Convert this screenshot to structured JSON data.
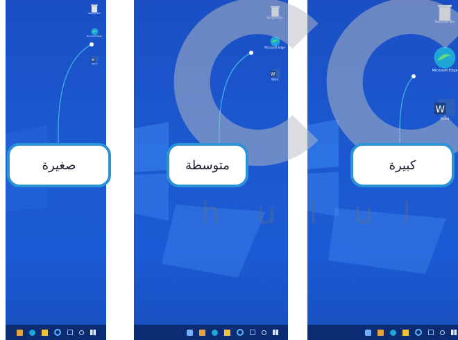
{
  "panels": [
    {
      "size_label": "صغيرة",
      "icons": [
        {
          "name": "recycle-bin",
          "label": "Recycle Bin"
        },
        {
          "name": "microsoft-edge",
          "label": "Microsoft Edge"
        },
        {
          "name": "word",
          "label": "Word"
        }
      ]
    },
    {
      "size_label": "متوسطة",
      "icons": [
        {
          "name": "recycle-bin",
          "label": "Recycle Bin"
        },
        {
          "name": "microsoft-edge",
          "label": "Microsoft Edge"
        },
        {
          "name": "word",
          "label": "Word"
        }
      ]
    },
    {
      "size_label": "كبيرة",
      "icons": [
        {
          "name": "recycle-bin",
          "label": "Recycle Bin"
        },
        {
          "name": "microsoft-edge",
          "label": "Microsoft Edge"
        },
        {
          "name": "word",
          "label": "Word"
        }
      ]
    }
  ],
  "taskbar_icons": [
    "store-icon",
    "file-explorer-icon",
    "edge-icon",
    "folder-icon",
    "cortana-icon",
    "task-view-icon",
    "search-icon",
    "start-icon"
  ],
  "colors": {
    "desktop_blue": "#1c59d0",
    "taskbar": "#0b2b72",
    "callout_border": "#2a92d6",
    "leader_line": "#3fb0e8"
  },
  "watermark": {
    "text": "hulul"
  }
}
